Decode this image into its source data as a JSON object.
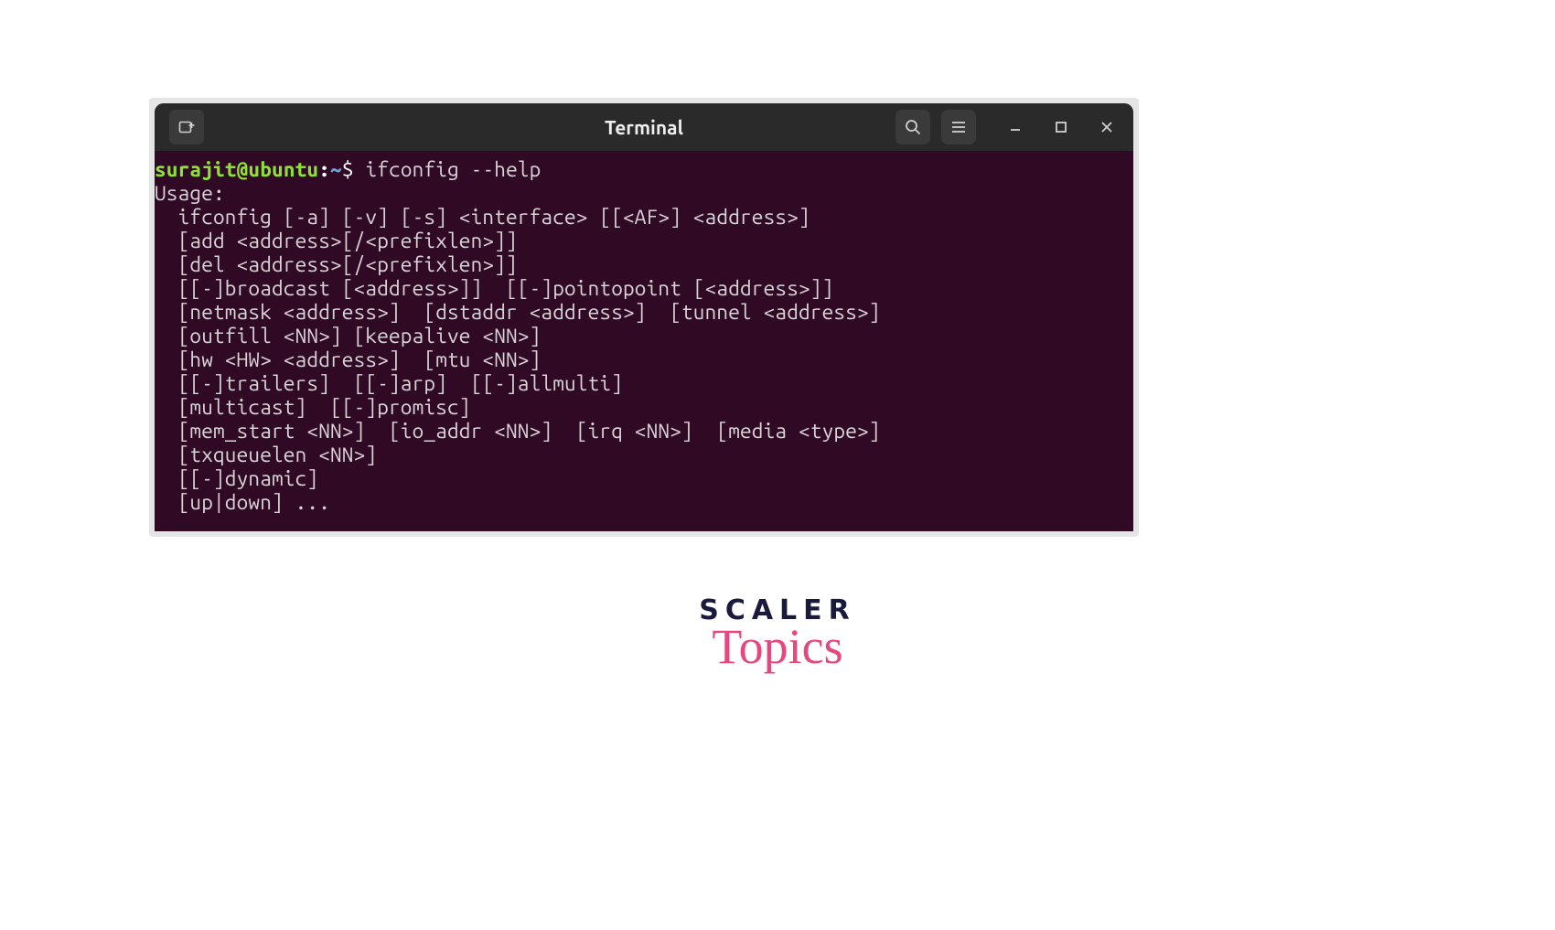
{
  "window": {
    "title": "Terminal",
    "icons": {
      "new_tab": "new-tab",
      "search": "search",
      "menu": "menu",
      "minimize": "minimize",
      "maximize": "maximize",
      "close": "close"
    }
  },
  "prompt": {
    "user": "surajit",
    "host": "ubuntu",
    "cwd": "~",
    "symbol": "$"
  },
  "command": "ifconfig --help",
  "output": {
    "lines": [
      "Usage:",
      "  ifconfig [-a] [-v] [-s] <interface> [[<AF>] <address>]",
      "  [add <address>[/<prefixlen>]]",
      "  [del <address>[/<prefixlen>]]",
      "  [[-]broadcast [<address>]]  [[-]pointopoint [<address>]]",
      "  [netmask <address>]  [dstaddr <address>]  [tunnel <address>]",
      "  [outfill <NN>] [keepalive <NN>]",
      "  [hw <HW> <address>]  [mtu <NN>]",
      "  [[-]trailers]  [[-]arp]  [[-]allmulti]",
      "  [multicast]  [[-]promisc]",
      "  [mem_start <NN>]  [io_addr <NN>]  [irq <NN>]  [media <type>]",
      "  [txqueuelen <NN>]",
      "  [[-]dynamic]",
      "  [up|down] ..."
    ]
  },
  "logo": {
    "word1": "SCALER",
    "word2": "Topics"
  }
}
